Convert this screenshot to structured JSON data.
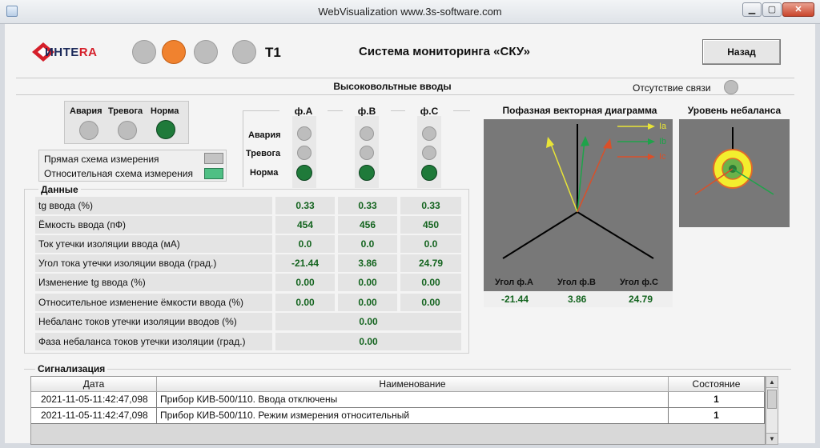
{
  "window": {
    "title": "WebVisualization www.3s-software.com"
  },
  "header": {
    "logo_text_1": "ИНТЕ",
    "logo_text_2": "RA",
    "transformer": "T1",
    "title": "Система мониторинга «СКУ»",
    "back_label": "Назад",
    "lamps": [
      "grey",
      "orange",
      "grey",
      "grey"
    ]
  },
  "section": {
    "title": "Высоковольтные вводы",
    "no_link_label": "Отсутствие связи"
  },
  "legend": {
    "labels": [
      "Авария",
      "Тревога",
      "Норма"
    ],
    "direct_scheme": "Прямая схема измерения",
    "relative_scheme": "Относительная схема измерения"
  },
  "phases": {
    "headers": [
      "ф.А",
      "ф.В",
      "ф.С"
    ],
    "row_labels": [
      "Авария",
      "Тревога",
      "Норма"
    ]
  },
  "data": {
    "title": "Данные",
    "rows": [
      {
        "label": "tg ввода (%)",
        "a": "0.33",
        "b": "0.33",
        "c": "0.33"
      },
      {
        "label": "Ёмкость ввода (пФ)",
        "a": "454",
        "b": "456",
        "c": "450"
      },
      {
        "label": "Ток утечки изоляции ввода (мА)",
        "a": "0.0",
        "b": "0.0",
        "c": "0.0"
      },
      {
        "label": "Угол тока утечки изоляции ввода (град.)",
        "a": "-21.44",
        "b": "3.86",
        "c": "24.79"
      },
      {
        "label": "Изменение tg ввода (%)",
        "a": "0.00",
        "b": "0.00",
        "c": "0.00"
      },
      {
        "label": "Относительное изменение ёмкости ввода (%)",
        "a": "0.00",
        "b": "0.00",
        "c": "0.00"
      },
      {
        "label": "Небаланс токов утечки изоляции вводов (%)",
        "total": "0.00"
      },
      {
        "label": "Фаза небаланса токов утечки изоляции (град.)",
        "total": "0.00"
      }
    ]
  },
  "vector_diagram": {
    "title": "Пофазная векторная диаграмма",
    "legend": [
      "Ia",
      "Ib",
      "Ic"
    ],
    "angle_labels": [
      "Угол ф.А",
      "Угол ф.В",
      "Угол ф.С"
    ],
    "angle_values": [
      "-21.44",
      "3.86",
      "24.79"
    ]
  },
  "unbalance": {
    "title": "Уровень небаланса"
  },
  "alarms": {
    "title": "Сигнализация",
    "columns": [
      "Дата",
      "Наименование",
      "Состояние"
    ],
    "rows": [
      {
        "date": "2021-11-05-11:42:47,098",
        "name": "Прибор КИВ-500/110. Ввода отключены",
        "state": "1"
      },
      {
        "date": "2021-11-05-11:42:47,098",
        "name": "Прибор КИВ-500/110. Режим измерения относительный",
        "state": "1"
      }
    ]
  },
  "colors": {
    "alarm_orange": "#f0822f",
    "norm_green": "#1f7a3a",
    "value_green": "#14641f",
    "vector_ia": "#e8e437",
    "vector_ib": "#1fa24a",
    "vector_ic": "#d9502a"
  }
}
